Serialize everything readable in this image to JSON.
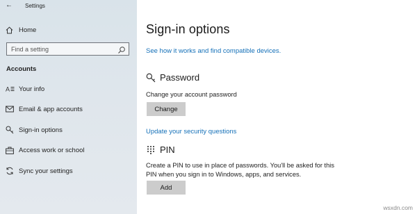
{
  "window": {
    "title": "Settings",
    "back_glyph": "←"
  },
  "sidebar": {
    "home_label": "Home",
    "search_placeholder": "Find a setting",
    "section_header": "Accounts",
    "items": [
      {
        "label": "Your info",
        "icon": "person-card-icon"
      },
      {
        "label": "Email & app accounts",
        "icon": "mail-icon"
      },
      {
        "label": "Sign-in options",
        "icon": "key-icon",
        "active": true
      },
      {
        "label": "Access work or school",
        "icon": "briefcase-icon"
      },
      {
        "label": "Sync your settings",
        "icon": "sync-icon"
      }
    ]
  },
  "main": {
    "title": "Sign-in options",
    "compat_link": "See how it works and find compatible devices.",
    "password": {
      "title": "Password",
      "description": "Change your account password",
      "button": "Change",
      "security_link": "Update your security questions"
    },
    "pin": {
      "title": "PIN",
      "description_lines": [
        "Create a PIN to use in place of passwords. You'll be asked for this",
        "PIN when you sign in to Windows, apps, and services."
      ],
      "button": "Add"
    }
  },
  "watermark": "wsxdn.com",
  "colors": {
    "accent_link": "#1470b8",
    "sidebar_bg": "#dfe6ec",
    "button_bg": "#cccccc"
  }
}
